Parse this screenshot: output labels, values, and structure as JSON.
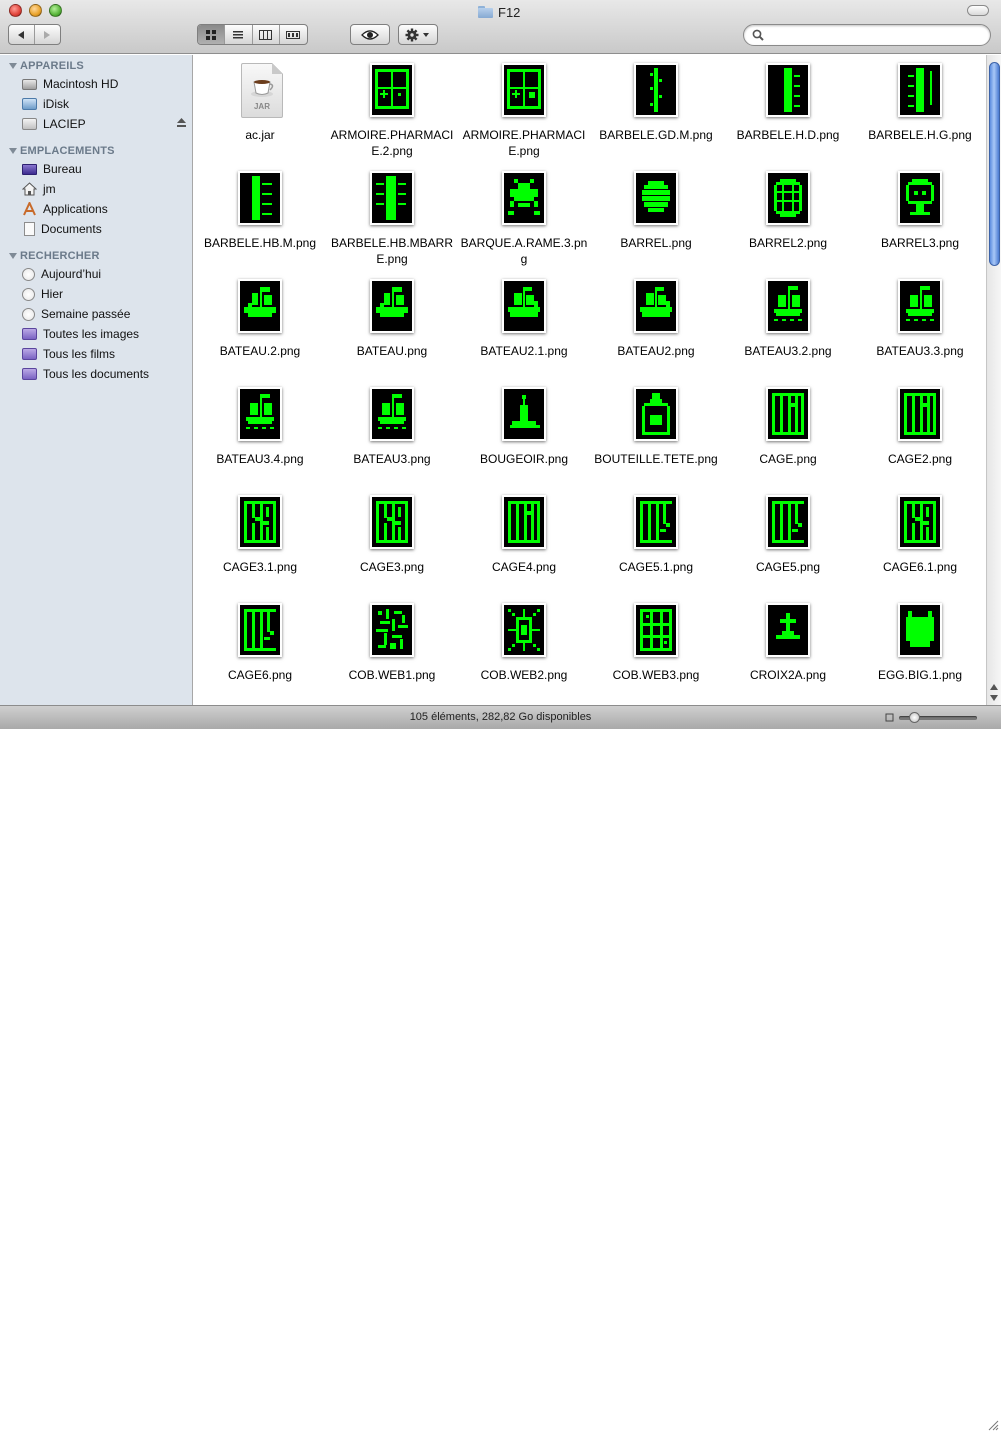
{
  "window": {
    "title": "F12",
    "colors": {
      "thumb_green": "#00ff00",
      "thumb_bg": "#000000",
      "sidebar_bg": "#dde4ec",
      "scroll_knob": "#6f9be6"
    }
  },
  "toolbar": {
    "back_icon": "left-arrow-icon",
    "forward_icon": "right-arrow-icon",
    "views": [
      "icon-view",
      "list-view",
      "column-view",
      "coverflow-view"
    ],
    "active_view": "icon-view",
    "quicklook_icon": "eye-icon",
    "action_icon": "gear-icon",
    "search_placeholder": ""
  },
  "sidebar": {
    "sections": [
      {
        "header": "APPAREILS",
        "items": [
          "Macintosh HD",
          "iDisk",
          "LACIEP"
        ]
      },
      {
        "header": "EMPLACEMENTS",
        "items": [
          "Bureau",
          "jm",
          "Applications",
          "Documents"
        ]
      },
      {
        "header": "RECHERCHER",
        "items": [
          "Aujourd’hui",
          "Hier",
          "Semaine passée",
          "Toutes les images",
          "Tous les films",
          "Tous les documents"
        ]
      }
    ]
  },
  "files": [
    {
      "name": "ac.jar",
      "kind": "jar",
      "badge": "JAR"
    },
    {
      "name": "ARMOIRE.PHARMACIE.2.png",
      "kind": "cabinet"
    },
    {
      "name": "ARMOIRE.PHARMACIE.png",
      "kind": "cabinet2"
    },
    {
      "name": "BARBELE.GD.M.png",
      "kind": "barbed-v"
    },
    {
      "name": "BARBELE.H.D.png",
      "kind": "barbed-r"
    },
    {
      "name": "BARBELE.H.G.png",
      "kind": "barbed-l"
    },
    {
      "name": "BARBELE.HB.M.png",
      "kind": "barbed-hb"
    },
    {
      "name": "BARBELE.HB.MBARRE.png",
      "kind": "barbed-hb2"
    },
    {
      "name": "BARQUE.A.RAME.3.png",
      "kind": "boat-oar"
    },
    {
      "name": "BARREL.png",
      "kind": "barrel"
    },
    {
      "name": "BARREL2.png",
      "kind": "barrel2"
    },
    {
      "name": "BARREL3.png",
      "kind": "barrel3"
    },
    {
      "name": "BATEAU.2.png",
      "kind": "ship"
    },
    {
      "name": "BATEAU.png",
      "kind": "ship"
    },
    {
      "name": "BATEAU2.1.png",
      "kind": "ship2"
    },
    {
      "name": "BATEAU2.png",
      "kind": "ship2"
    },
    {
      "name": "BATEAU3.2.png",
      "kind": "ship3"
    },
    {
      "name": "BATEAU3.3.png",
      "kind": "ship3"
    },
    {
      "name": "BATEAU3.4.png",
      "kind": "ship3"
    },
    {
      "name": "BATEAU3.png",
      "kind": "ship3"
    },
    {
      "name": "BOUGEOIR.png",
      "kind": "candle"
    },
    {
      "name": "BOUTEILLE.TETE.png",
      "kind": "bottle"
    },
    {
      "name": "CAGE.png",
      "kind": "cage"
    },
    {
      "name": "CAGE2.png",
      "kind": "cage"
    },
    {
      "name": "CAGE3.1.png",
      "kind": "cage-broken"
    },
    {
      "name": "CAGE3.png",
      "kind": "cage-broken"
    },
    {
      "name": "CAGE4.png",
      "kind": "cage"
    },
    {
      "name": "CAGE5.1.png",
      "kind": "cage-open"
    },
    {
      "name": "CAGE5.png",
      "kind": "cage-open"
    },
    {
      "name": "CAGE6.1.png",
      "kind": "cage-broken"
    },
    {
      "name": "CAGE6.png",
      "kind": "cage-open"
    },
    {
      "name": "COB.WEB1.png",
      "kind": "web"
    },
    {
      "name": "COB.WEB2.png",
      "kind": "web2"
    },
    {
      "name": "COB.WEB3.png",
      "kind": "web3"
    },
    {
      "name": "CROIX2A.png",
      "kind": "cross"
    },
    {
      "name": "EGG.BIG.1.png",
      "kind": "egg"
    }
  ],
  "status": {
    "text": "105 éléments, 282,82 Go disponibles"
  }
}
